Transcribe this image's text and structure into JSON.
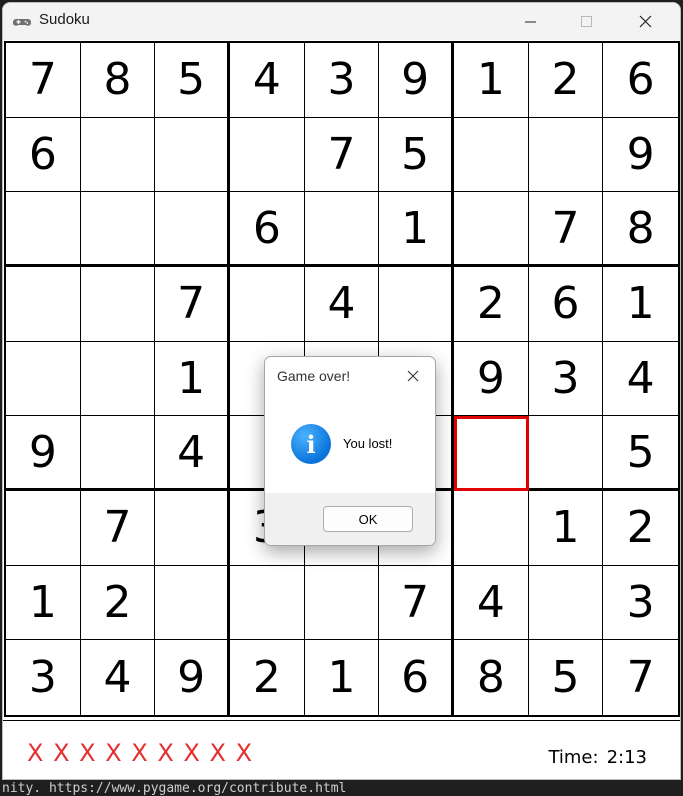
{
  "window": {
    "title": "Sudoku",
    "controls": [
      "minimize",
      "maximize",
      "close"
    ]
  },
  "background_console_text": "nity. https://www.pygame.org/contribute.html",
  "board": {
    "rows": [
      [
        "7",
        "8",
        "5",
        "4",
        "3",
        "9",
        "1",
        "2",
        "6"
      ],
      [
        "6",
        "",
        "",
        "",
        "7",
        "5",
        "",
        "",
        "9"
      ],
      [
        "",
        "",
        "",
        "6",
        "",
        "1",
        "",
        "7",
        "8"
      ],
      [
        "",
        "",
        "7",
        "",
        "4",
        "",
        "2",
        "6",
        "1"
      ],
      [
        "",
        "",
        "1",
        "",
        "",
        "",
        "9",
        "3",
        "4"
      ],
      [
        "9",
        "",
        "4",
        "",
        "",
        "",
        "",
        "",
        "5"
      ],
      [
        "",
        "7",
        "",
        "3",
        "",
        "",
        "",
        "1",
        "2"
      ],
      [
        "1",
        "2",
        "",
        "",
        "",
        "7",
        "4",
        "",
        "3"
      ],
      [
        "3",
        "4",
        "9",
        "2",
        "1",
        "6",
        "8",
        "5",
        "7"
      ]
    ],
    "selected_cell": {
      "row": 5,
      "col": 6
    },
    "selected_color": "#e00000"
  },
  "footer": {
    "strikes": "X X X X X X X X X",
    "strike_color": "#e53030",
    "time_label": "Time:",
    "time_value": "2:13"
  },
  "dialog": {
    "title": "Game over!",
    "icon": "info-icon",
    "message": "You lost!",
    "ok_label": "OK"
  }
}
